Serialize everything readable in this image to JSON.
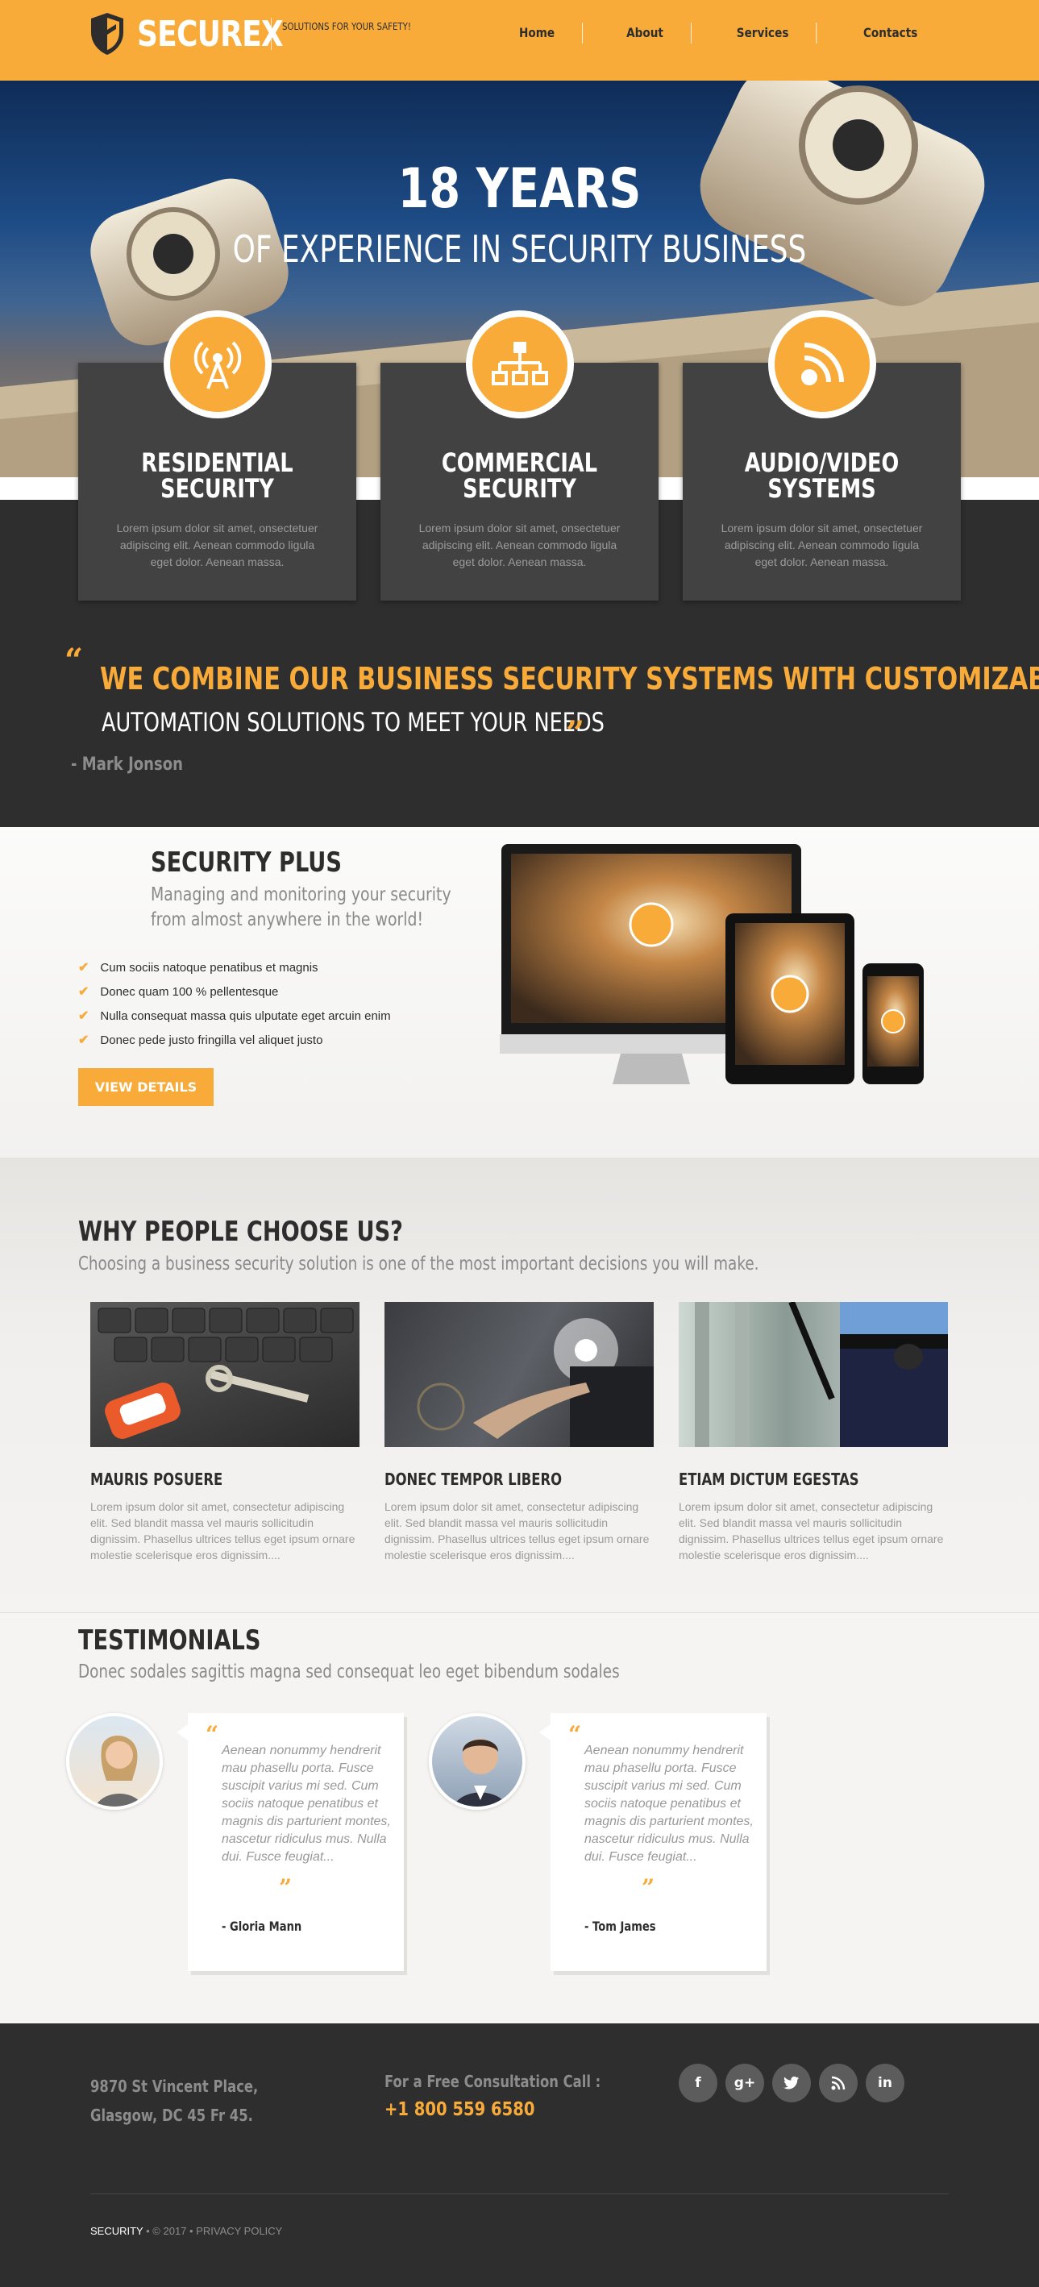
{
  "header": {
    "logo": "SECUREX",
    "tagline": "SOLUTIONS FOR YOUR SAFETY!",
    "nav": [
      "Home",
      "About",
      "Services",
      "Contacts"
    ],
    "accent": "#f9ab3a"
  },
  "hero": {
    "title": "18 YEARS",
    "subtitle": "OF EXPERIENCE IN SECURITY BUSINESS"
  },
  "services": [
    {
      "icon": "antenna-icon",
      "title_l1": "RESIDENTIAL",
      "title_l2": "SECURITY",
      "text": "Lorem ipsum dolor sit amet, onsectetuer adipiscing elit. Aenean commodo ligula eget dolor. Aenean massa."
    },
    {
      "icon": "network-icon",
      "title_l1": "COMMERCIAL",
      "title_l2": "SECURITY",
      "text": "Lorem ipsum dolor sit amet, onsectetuer adipiscing elit. Aenean commodo ligula eget dolor. Aenean massa."
    },
    {
      "icon": "rss-icon",
      "title_l1": "AUDIO/VIDEO",
      "title_l2": "SYSTEMS",
      "text": "Lorem ipsum dolor sit amet, onsectetuer adipiscing elit. Aenean commodo ligula eget dolor. Aenean massa."
    }
  ],
  "quote": {
    "line1": "WE COMBINE OUR BUSINESS SECURITY SYSTEMS WITH CUSTOMIZABLE",
    "line2": "AUTOMATION SOLUTIONS TO MEET YOUR NEEDS",
    "author": "- Mark Jonson"
  },
  "security_plus": {
    "title": "SECURITY PLUS",
    "subtitle": "Managing and monitoring your security from almost anywhere in the world!",
    "items": [
      "Cum sociis natoque penatibus et magnis",
      "Donec quam 100 % pellentesque",
      "Nulla consequat massa quis ulputate eget arcuin enim",
      "Donec pede justo fringilla vel aliquet justo"
    ],
    "button": "VIEW DETAILS"
  },
  "why": {
    "title": "WHY PEOPLE CHOOSE US?",
    "subtitle": "Choosing a business security solution is one of the most important decisions you will make.",
    "cards": [
      {
        "title": "MAURIS POSUERE",
        "text": "Lorem ipsum dolor sit amet, consectetur adipiscing elit. Sed blandit massa vel mauris sollicitudin dignissim. Phasellus ultrices tellus eget ipsum ornare molestie scelerisque eros dignissim...."
      },
      {
        "title": "DONEC TEMPOR LIBERO",
        "text": "Lorem ipsum dolor sit amet, consectetur adipiscing elit. Sed blandit massa vel mauris sollicitudin dignissim. Phasellus ultrices tellus eget ipsum ornare molestie scelerisque eros dignissim...."
      },
      {
        "title": "ETIAM DICTUM EGESTAS",
        "text": "Lorem ipsum dolor sit amet, consectetur adipiscing elit. Sed blandit massa vel mauris sollicitudin dignissim. Phasellus ultrices tellus eget ipsum ornare molestie scelerisque eros dignissim...."
      }
    ]
  },
  "testimonials": {
    "title": "TESTIMONIALS",
    "subtitle": "Donec sodales sagittis magna sed consequat leo eget bibendum sodales",
    "items": [
      {
        "quote": "Aenean nonummy hendrerit mau phasellu porta. Fusce suscipit varius mi sed. Cum sociis natoque penatibus et magnis dis parturient montes, nascetur ridiculus mus. Nulla dui. Fusce feugiat...",
        "name": "- Gloria Mann"
      },
      {
        "quote": "Aenean nonummy hendrerit mau phasellu porta. Fusce suscipit varius mi sed. Cum sociis natoque penatibus et magnis dis parturient montes, nascetur ridiculus mus. Nulla dui. Fusce feugiat...",
        "name": "- Tom James"
      }
    ]
  },
  "footer": {
    "address_l1": "9870 St Vincent Place,",
    "address_l2": "Glasgow, DC 45 Fr 45.",
    "consult_label": "For a Free Consultation Call :",
    "phone": "+1 800 559 6580",
    "socials": [
      "f",
      "g+",
      "t",
      "rss",
      "in"
    ],
    "brand": "SECURITY",
    "copyright": "• © 2017 •",
    "privacy": "PRIVACY POLICY"
  }
}
